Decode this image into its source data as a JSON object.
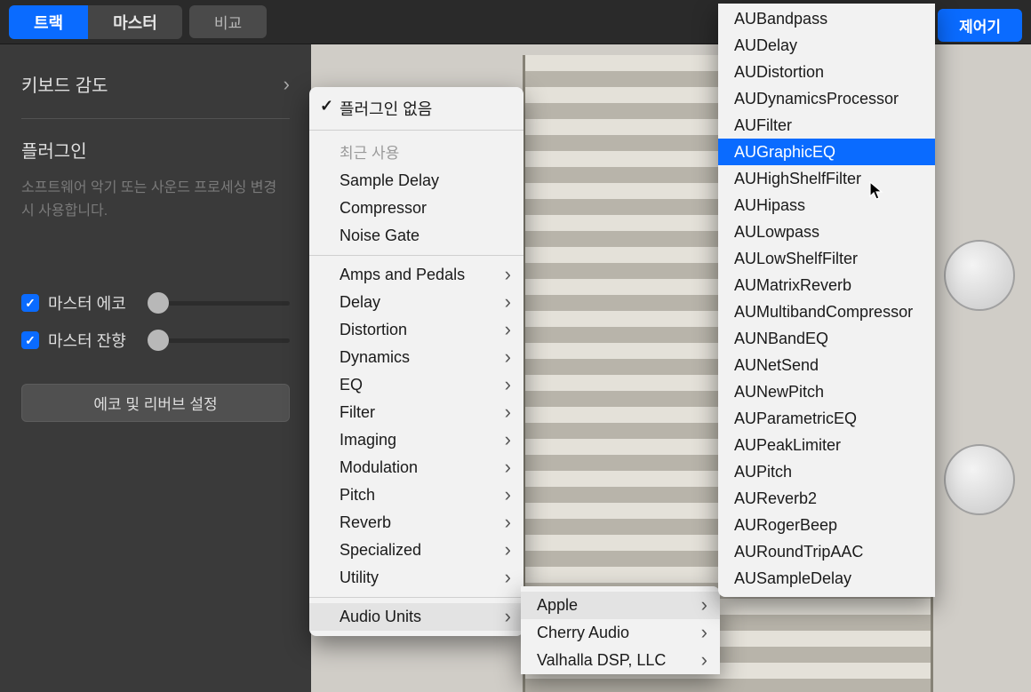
{
  "topbar": {
    "tabs": {
      "track": "트랙",
      "master": "마스터"
    },
    "compare": "비교",
    "control": "제어기"
  },
  "sidebar": {
    "keyboard_sensitivity": "키보드 감도",
    "plugins_title": "플러그인",
    "plugins_desc": "소프트웨어 악기 또는 사운드 프로세싱 변경 시 사용합니다.",
    "master_echo": "마스터 에코",
    "master_reverb": "마스터 잔향",
    "echo_reverb_btn": "에코 및 리버브 설정"
  },
  "menu1": {
    "no_plugin": "플러그인 없음",
    "recent_header": "최근 사용",
    "recent": [
      "Sample Delay",
      "Compressor",
      "Noise Gate"
    ],
    "categories": [
      "Amps and Pedals",
      "Delay",
      "Distortion",
      "Dynamics",
      "EQ",
      "Filter",
      "Imaging",
      "Modulation",
      "Pitch",
      "Reverb",
      "Specialized",
      "Utility"
    ],
    "audio_units": "Audio Units"
  },
  "menu2": {
    "vendors": [
      "Apple",
      "Cherry Audio",
      "Valhalla DSP, LLC"
    ]
  },
  "menu3": {
    "items": [
      "AUBandpass",
      "AUDelay",
      "AUDistortion",
      "AUDynamicsProcessor",
      "AUFilter",
      "AUGraphicEQ",
      "AUHighShelfFilter",
      "AUHipass",
      "AULowpass",
      "AULowShelfFilter",
      "AUMatrixReverb",
      "AUMultibandCompressor",
      "AUNBandEQ",
      "AUNetSend",
      "AUNewPitch",
      "AUParametricEQ",
      "AUPeakLimiter",
      "AUPitch",
      "AUReverb2",
      "AURogerBeep",
      "AURoundTripAAC",
      "AUSampleDelay"
    ],
    "selected_index": 5
  }
}
